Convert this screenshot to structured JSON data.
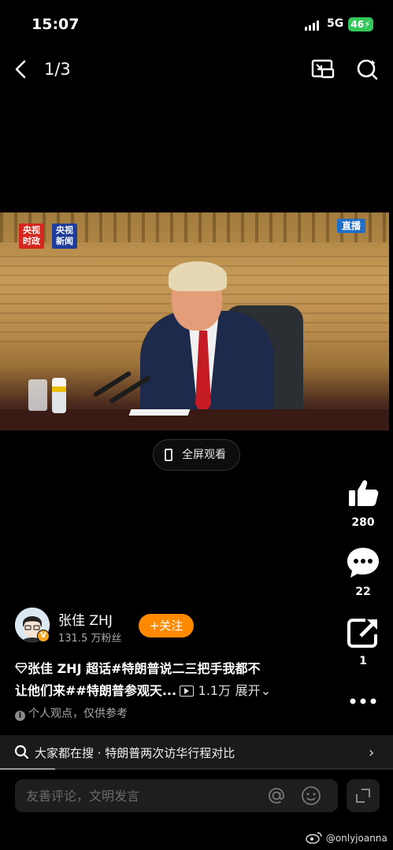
{
  "status": {
    "time": "15:07",
    "network": "5G",
    "battery": "46"
  },
  "nav": {
    "counter": "1/3"
  },
  "video": {
    "logo_left": "央视\n时政",
    "logo_right": "央视\n新闻",
    "live_badge": "直播"
  },
  "fullscreen_label": "全屏观看",
  "actions": {
    "likes": "280",
    "comments": "22",
    "shares": "1"
  },
  "author": {
    "name": "张佳 ZHJ",
    "fans": "131.5 万粉丝",
    "follow_label": "+关注",
    "badge": "V"
  },
  "caption": {
    "line1": "张佳 ZHJ 超话#特朗普说二三把手我都不",
    "line2": "让他们来##特朗普参观天...",
    "views": "1.1万",
    "expand": "展开"
  },
  "disclaimer": "个人观点，仅供参考",
  "search": {
    "text": "大家都在搜 · 特朗普两次访华行程对比"
  },
  "progress": 0.14,
  "comment": {
    "placeholder": "友善评论，文明发言"
  },
  "watermark": "@onlyjoanna",
  "colors": {
    "accent": "#ff8a00",
    "battery": "#34c759"
  }
}
